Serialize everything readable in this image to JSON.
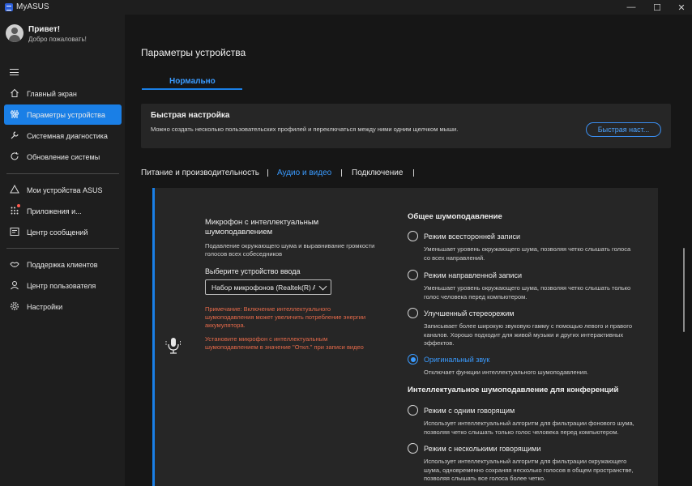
{
  "window": {
    "title": "MyASUS",
    "minimize": "—",
    "maximize": "☐",
    "close": "✕"
  },
  "user": {
    "greeting": "Привет!",
    "welcome": "Добро пожаловать!"
  },
  "sidebar": {
    "items": [
      {
        "label": "Главный экран",
        "icon": "home-icon"
      },
      {
        "label": "Параметры устройства",
        "icon": "sliders-icon"
      },
      {
        "label": "Системная диагностика",
        "icon": "wrench-icon"
      },
      {
        "label": "Обновление системы",
        "icon": "refresh-icon"
      },
      {
        "label": "Мои устройства ASUS",
        "icon": "devices-icon"
      },
      {
        "label": "Приложения и...",
        "icon": "apps-icon"
      },
      {
        "label": "Центр сообщений",
        "icon": "message-icon"
      },
      {
        "label": "Поддержка клиентов",
        "icon": "support-icon"
      },
      {
        "label": "Центр пользователя",
        "icon": "user-icon"
      },
      {
        "label": "Настройки",
        "icon": "gear-icon"
      }
    ]
  },
  "main": {
    "title": "Параметры устройства",
    "profile_tab": "Нормально",
    "quick": {
      "title": "Быстрая настройка",
      "description": "Можно создать несколько пользовательских профилей и переключаться между ними одним щелчком мыши.",
      "button": "Быстрая наст..."
    },
    "tabs": [
      {
        "label": "Питание и производительность",
        "active": false
      },
      {
        "label": "Аудио и видео",
        "active": true
      },
      {
        "label": "Подключение",
        "active": false
      }
    ],
    "mic": {
      "title": "Микрофон с интеллектуальным шумоподавлением",
      "description": "Подавление окружающего шума и выравнивание громкости голосов всех собеседников",
      "select_label": "Выберите устройство ввода",
      "select_value": "Набор микрофонов (Realtek(R) Audio)",
      "note1": "Примечание: Включение интеллектуального шумоподавления может увеличить потребление энергии аккумулятора.",
      "note2": "Установите микрофон с интеллектуальным шумоподавлением в значение \"Откл.\" при записи видео"
    },
    "general": {
      "title": "Общее шумоподавление",
      "options": [
        {
          "label": "Режим всесторонней записи",
          "desc": "Уменьшает уровень окружающего шума, позволяя четко слышать голоса со всех направлений.",
          "selected": false
        },
        {
          "label": "Режим направленной записи",
          "desc": "Уменьшает уровень окружающего шума, позволяя четко слышать только голос человека перед компьютером.",
          "selected": false
        },
        {
          "label": "Улучшенный стереорежим",
          "desc": "Записывает более широкую звуковую гамму с помощью левого и правого каналов. Хорошо подходит для живой музыки и других интерактивных эффектов.",
          "selected": false
        },
        {
          "label": "Оригинальный звук",
          "desc": "Отключает функции интеллектуального шумоподавления.",
          "selected": true
        }
      ]
    },
    "conference": {
      "title": "Интеллектуальное шумоподавление для конференций",
      "options": [
        {
          "label": "Режим с одним говорящим",
          "desc": "Использует интеллектуальный алгоритм для фильтрации фонового шума, позволяя четко слышать только голос человека перед компьютером.",
          "selected": false
        },
        {
          "label": "Режим с несколькими говорящими",
          "desc": "Использует интеллектуальный алгоритм для фильтрации окружающего шума, одновременно сохраняя несколько голосов в общем пространстве, позволяя слышать все голоса более четко.",
          "selected": false
        }
      ]
    }
  },
  "colors": {
    "accent": "#1a7fe6",
    "accent_text": "#3a9bff",
    "warning": "#e66a4a",
    "panel": "#262626",
    "sidebar": "#1e1e1e",
    "background": "#161616"
  }
}
